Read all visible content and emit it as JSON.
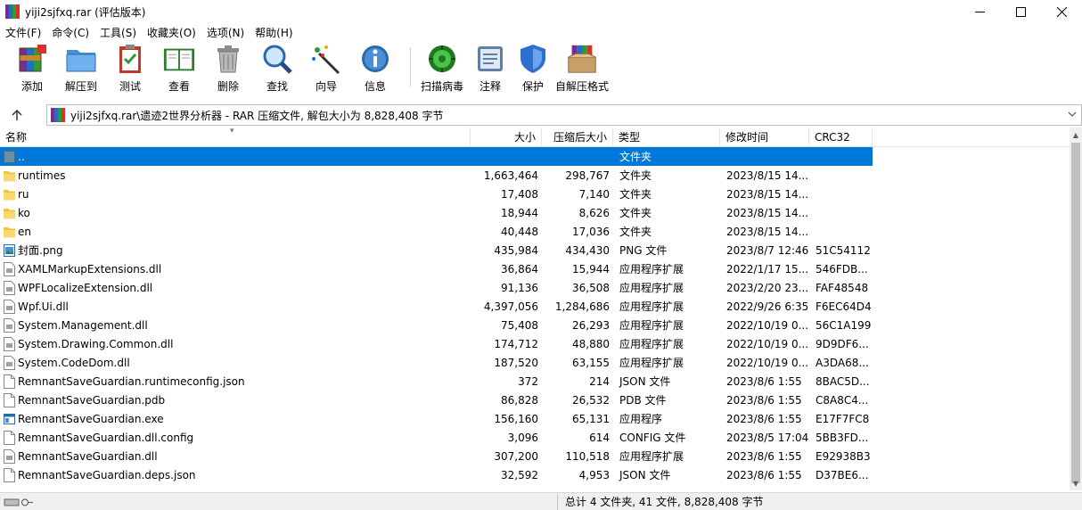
{
  "window": {
    "title": "yiji2sjfxq.rar (评估版本)"
  },
  "menu": [
    "文件(F)",
    "命令(C)",
    "工具(S)",
    "收藏夹(O)",
    "选项(N)",
    "帮助(H)"
  ],
  "toolbar": [
    {
      "label": "添加",
      "icon": "archive-add-icon"
    },
    {
      "label": "解压到",
      "icon": "extract-folder-icon"
    },
    {
      "label": "测试",
      "icon": "test-clipboard-icon"
    },
    {
      "label": "查看",
      "icon": "view-book-icon"
    },
    {
      "label": "删除",
      "icon": "trash-icon"
    },
    {
      "label": "查找",
      "icon": "magnifier-icon"
    },
    {
      "label": "向导",
      "icon": "wizard-wand-icon"
    },
    {
      "label": "信息",
      "icon": "info-icon"
    },
    {
      "label": "扫描病毒",
      "icon": "virus-scan-icon"
    },
    {
      "label": "注释",
      "icon": "comment-icon"
    },
    {
      "label": "保护",
      "icon": "shield-icon"
    },
    {
      "label": "自解压格式",
      "icon": "sfx-box-icon"
    }
  ],
  "address": {
    "path": "yiji2sjfxq.rar\\遗迹2世界分析器 - RAR 压缩文件, 解包大小为 8,828,408 字节"
  },
  "columns": [
    "名称",
    "大小",
    "压缩后大小",
    "类型",
    "修改时间",
    "CRC32"
  ],
  "files": [
    {
      "name": "..",
      "size": "",
      "packed": "",
      "type": "文件夹",
      "modified": "",
      "crc": "",
      "icon": "parent-dir"
    },
    {
      "name": "runtimes",
      "size": "1,663,464",
      "packed": "298,767",
      "type": "文件夹",
      "modified": "2023/8/15 14...",
      "crc": "",
      "icon": "folder"
    },
    {
      "name": "ru",
      "size": "17,408",
      "packed": "7,140",
      "type": "文件夹",
      "modified": "2023/8/15 14...",
      "crc": "",
      "icon": "folder"
    },
    {
      "name": "ko",
      "size": "18,944",
      "packed": "8,626",
      "type": "文件夹",
      "modified": "2023/8/15 14...",
      "crc": "",
      "icon": "folder"
    },
    {
      "name": "en",
      "size": "40,448",
      "packed": "17,036",
      "type": "文件夹",
      "modified": "2023/8/15 14...",
      "crc": "",
      "icon": "folder"
    },
    {
      "name": "封面.png",
      "size": "435,984",
      "packed": "434,430",
      "type": "PNG 文件",
      "modified": "2023/8/7 12:46",
      "crc": "51C54112",
      "icon": "image"
    },
    {
      "name": "XAMLMarkupExtensions.dll",
      "size": "36,864",
      "packed": "15,944",
      "type": "应用程序扩展",
      "modified": "2022/1/17 15...",
      "crc": "546FDB...",
      "icon": "dll"
    },
    {
      "name": "WPFLocalizeExtension.dll",
      "size": "91,136",
      "packed": "36,508",
      "type": "应用程序扩展",
      "modified": "2023/2/20 23...",
      "crc": "FAF48548",
      "icon": "dll"
    },
    {
      "name": "Wpf.Ui.dll",
      "size": "4,397,056",
      "packed": "1,284,686",
      "type": "应用程序扩展",
      "modified": "2022/9/26 6:35",
      "crc": "F6EC64D4",
      "icon": "dll"
    },
    {
      "name": "System.Management.dll",
      "size": "75,408",
      "packed": "26,293",
      "type": "应用程序扩展",
      "modified": "2022/10/19 0...",
      "crc": "56C1A199",
      "icon": "dll"
    },
    {
      "name": "System.Drawing.Common.dll",
      "size": "174,712",
      "packed": "48,880",
      "type": "应用程序扩展",
      "modified": "2022/10/19 0...",
      "crc": "9D9DF6...",
      "icon": "dll"
    },
    {
      "name": "System.CodeDom.dll",
      "size": "187,520",
      "packed": "63,155",
      "type": "应用程序扩展",
      "modified": "2022/10/19 0...",
      "crc": "A3DA68...",
      "icon": "dll"
    },
    {
      "name": "RemnantSaveGuardian.runtimeconfig.json",
      "size": "372",
      "packed": "214",
      "type": "JSON 文件",
      "modified": "2023/8/6 1:55",
      "crc": "8BAC5D...",
      "icon": "doc"
    },
    {
      "name": "RemnantSaveGuardian.pdb",
      "size": "86,828",
      "packed": "26,532",
      "type": "PDB 文件",
      "modified": "2023/8/6 1:55",
      "crc": "C8A8C4...",
      "icon": "doc"
    },
    {
      "name": "RemnantSaveGuardian.exe",
      "size": "156,160",
      "packed": "65,131",
      "type": "应用程序",
      "modified": "2023/8/6 1:55",
      "crc": "E17F7FC8",
      "icon": "exe"
    },
    {
      "name": "RemnantSaveGuardian.dll.config",
      "size": "3,096",
      "packed": "614",
      "type": "CONFIG 文件",
      "modified": "2023/8/5 17:04",
      "crc": "5BB3FD...",
      "icon": "doc"
    },
    {
      "name": "RemnantSaveGuardian.dll",
      "size": "307,200",
      "packed": "110,518",
      "type": "应用程序扩展",
      "modified": "2023/8/6 1:55",
      "crc": "E92938B3",
      "icon": "dll"
    },
    {
      "name": "RemnantSaveGuardian.deps.json",
      "size": "32,592",
      "packed": "4,953",
      "type": "JSON 文件",
      "modified": "2023/8/6 1:55",
      "crc": "D37BE6...",
      "icon": "doc"
    }
  ],
  "status": {
    "summary": "总计 4 文件夹, 41 文件, 8,828,408 字节"
  }
}
